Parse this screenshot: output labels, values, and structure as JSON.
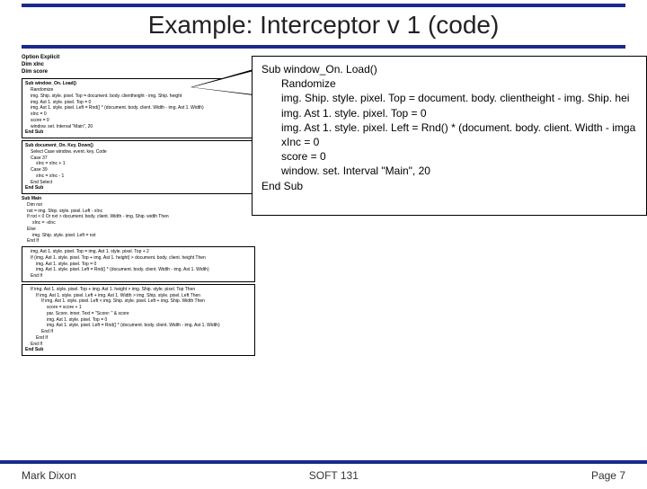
{
  "title": "Example: Interceptor v 1 (code)",
  "footer": {
    "left": "Mark Dixon",
    "center": "SOFT 131",
    "right": "Page 7"
  },
  "decl": [
    "Option Explicit",
    "Dim xInc",
    "Dim score"
  ],
  "box_load": [
    "Sub window_On. Load()",
    " Randomize",
    " img. Ship. style. pixel. Top = document. body. clientheight - img. Ship. height",
    " img. Ast 1. style. pixel. Top = 0",
    " img. Ast 1. style. pixel. Left = Rnd() * (document. body. client. Width - img. Ast 1. Width)",
    " xInc = 0",
    " score = 0",
    " window. set. Interval \"Main\", 20",
    "End Sub"
  ],
  "box_key": [
    "Sub document_On. Key. Down()",
    " Select Case window. event. key. Code",
    " Case 37",
    "   xInc = xInc + 1",
    " Case 39",
    "   xInc = xInc - 1",
    " End Select",
    "End Sub"
  ],
  "main_head": [
    "Sub Main",
    " Dim nxt",
    " nxt = img. Ship. style. pixel. Left - xInc",
    " If nxt < 0  Or nxt > document. body. client. Width - img. Ship. width Then",
    "   xInc = -xInc",
    " Else",
    "   img. Ship. style. pixel. Left = nxt",
    " End If"
  ],
  "main_ast": [
    " img. Ast 1. style. pixel. Top = img. Ast 1. style. pixel. Top + 2",
    " If (img. Ast 1. style. pixel. Top + img. Ast 1. height) > document. body. client. height Then",
    "   img. Ast 1. style. pixel. Top = 0",
    "   img. Ast 1. style. pixel. Left = Rnd() * (document. body. client. Width - img. Ast 1. Width)",
    " End If"
  ],
  "main_hit": [
    " If img. Ast 1. style. pixel. Top + img. Ast 1. height > img. Ship. style. pixel. Top Then",
    "  If img. Ast 1. style. pixel. Left + img. Ast 1. Width > img. Ship. style. pixel. Left Then",
    "   If img. Ast 1. style. pixel. Left < img. Ship. style. pixel. Left + img. Ship. Width Then",
    "    score = score + 1",
    "    par. Score. inner. Text = \"Score: \" & score",
    "    img. Ast 1. style. pixel. Top = 0",
    "    img. Ast 1. style. pixel. Left = Rnd() * (document. body. client. Width - img. Ast 1. Width)",
    "   End If",
    "  End If",
    " End If",
    "End Sub"
  ],
  "zoom": [
    "Sub window_On. Load()",
    "Randomize",
    "img. Ship. style. pixel. Top = document. body. clientheight - img. Ship. hei",
    "img. Ast 1. style. pixel. Top = 0",
    "img. Ast 1. style. pixel. Left = Rnd() * (document. body. client. Width - imga",
    "xInc = 0",
    "score = 0",
    "window. set. Interval \"Main\", 20",
    "End Sub"
  ]
}
